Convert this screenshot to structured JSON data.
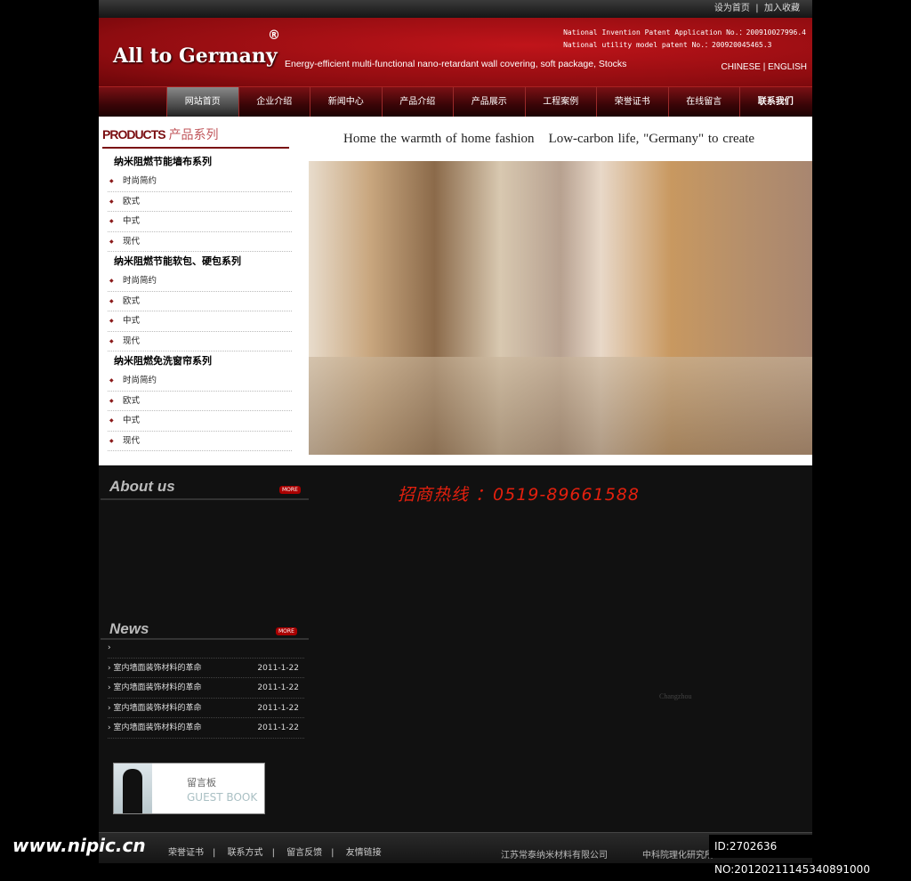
{
  "topbar": {
    "set_home": "设为首页",
    "separator": "|",
    "bookmark": "加入收藏"
  },
  "header": {
    "logo": "All to Germany",
    "registered": "®",
    "slogan": "Energy-efficient multi-functional nano-retardant wall covering, soft package, Stocks",
    "patent1": "National Invention Patent Application No.：200910027996.4",
    "patent2": "National utility model patent No.：200920045465.3",
    "lang": "CHINESE | ENGLISH"
  },
  "nav": [
    "网站首页",
    "企业介绍",
    "新闻中心",
    "产品介绍",
    "产品展示",
    "工程案例",
    "荣誉证书",
    "在线留言",
    "联系我们"
  ],
  "products": {
    "title_en": "PRODUCTS",
    "title_cn": "产品系列",
    "categories": [
      {
        "name": "纳米阻燃节能墙布系列",
        "items": [
          "时尚简约",
          "欧式",
          "中式",
          "现代"
        ]
      },
      {
        "name": "纳米阻燃节能软包、硬包系列",
        "items": [
          "时尚简约",
          "欧式",
          "中式",
          "现代"
        ]
      },
      {
        "name": "纳米阻燃免洗窗帘系列",
        "items": [
          "时尚简约",
          "欧式",
          "中式",
          "现代"
        ]
      }
    ]
  },
  "banner": {
    "tagline1": "Home the warmth of home fashion",
    "tagline2": "Low-carbon life, \"Germany\" to create"
  },
  "about": {
    "title": "About us",
    "more": "MORE"
  },
  "hotline": "招商热线 ：0519-89661588",
  "news": {
    "title": "News",
    "more": "MORE",
    "first": "›",
    "items": [
      {
        "title": "› 室内墙面装饰材料的革命",
        "date": "2011-1-22"
      },
      {
        "title": "› 室内墙面装饰材料的革命",
        "date": "2011-1-22"
      },
      {
        "title": "› 室内墙面装饰材料的革命",
        "date": "2011-1-22"
      },
      {
        "title": "› 室内墙面装饰材料的革命",
        "date": "2011-1-22"
      }
    ]
  },
  "guestbook": {
    "cn": "留言板",
    "en": "GUEST BOOK"
  },
  "city": "Changzhou",
  "footer": {
    "links": [
      "荣誉证书",
      "联系方式",
      "留言反馈",
      "友情链接"
    ],
    "company1": "江苏常泰纳米材料有限公司",
    "company2": "中科院理化研究所"
  },
  "watermark": {
    "site": "www.nipic.cn",
    "id": "ID:2702636 NO:20120211145340891000"
  }
}
